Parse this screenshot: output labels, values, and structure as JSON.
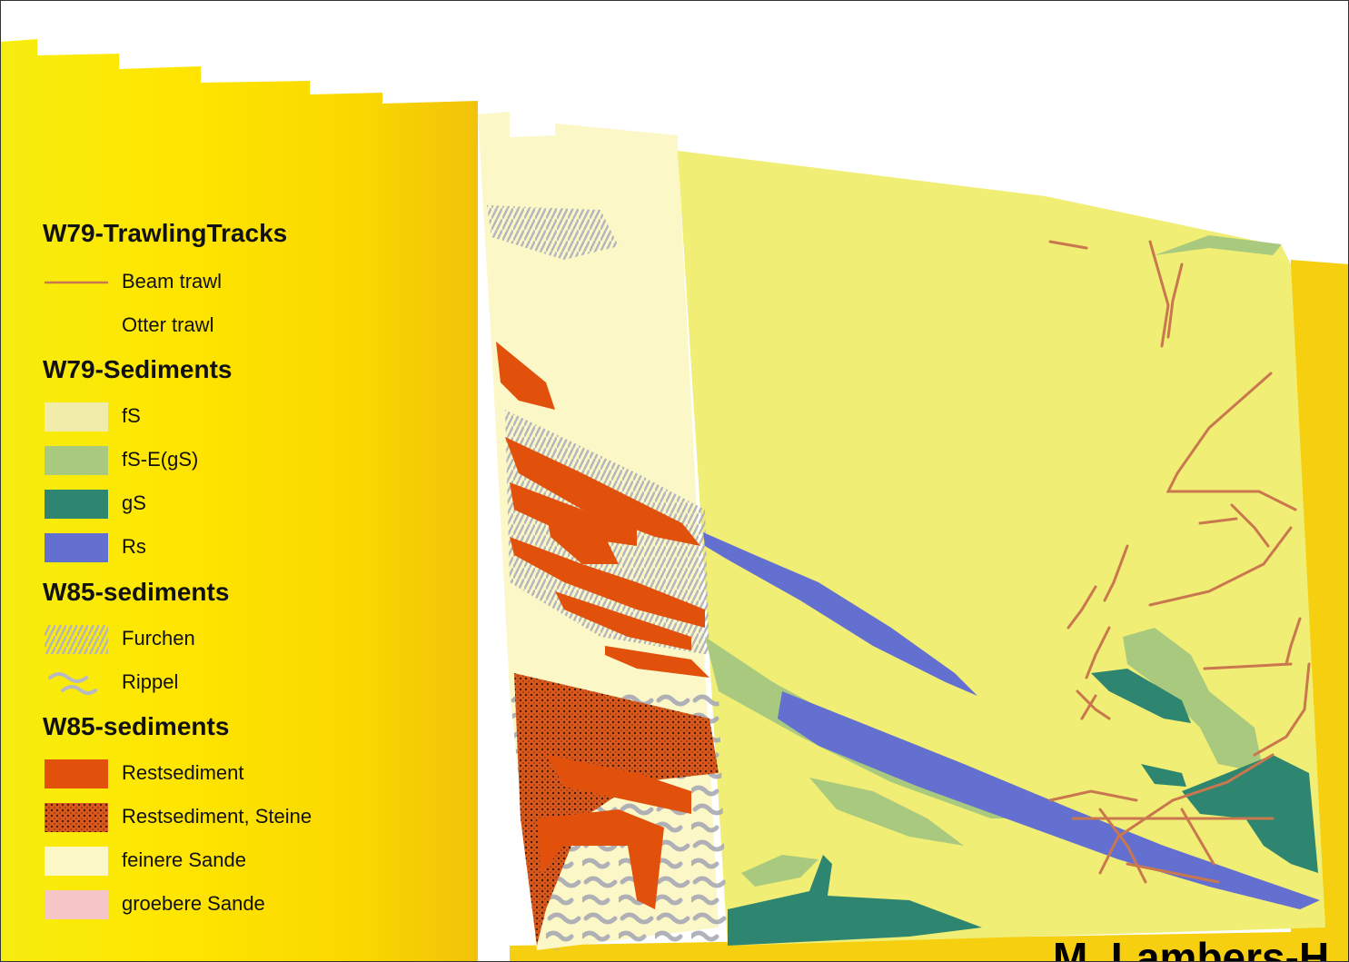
{
  "legend": {
    "groups": [
      {
        "title": "W79-TrawlingTracks",
        "items": [
          {
            "label": "Beam trawl",
            "symbol": "line",
            "color": "#c9774f"
          },
          {
            "label": "Otter trawl",
            "symbol": "none",
            "color": ""
          }
        ]
      },
      {
        "title": "W79-Sediments",
        "items": [
          {
            "label": "fS",
            "symbol": "fill",
            "color": "#f2ecaa"
          },
          {
            "label": "fS-E(gS)",
            "symbol": "fill",
            "color": "#a9c97e"
          },
          {
            "label": "gS",
            "symbol": "fill",
            "color": "#2f8670"
          },
          {
            "label": "Rs",
            "symbol": "fill",
            "color": "#6470d0"
          }
        ]
      },
      {
        "title": "W85-sediments",
        "items": [
          {
            "label": "Furchen",
            "symbol": "hatch",
            "color": "#b9b9c2"
          },
          {
            "label": "Rippel",
            "symbol": "ripple",
            "color": "#b9b9c2"
          }
        ]
      },
      {
        "title": "W85-sediments",
        "items": [
          {
            "label": "Restsediment",
            "symbol": "fill",
            "color": "#e2510c"
          },
          {
            "label": "Restsediment, Steine",
            "symbol": "dots",
            "color": "#c44a18"
          },
          {
            "label": "feinere Sande",
            "symbol": "fill",
            "color": "#fbf7c6"
          },
          {
            "label": "groebere Sande",
            "symbol": "fill",
            "color": "#f6c5c8"
          }
        ]
      }
    ]
  },
  "author_label": "M. Lambers-H",
  "colors": {
    "background_yellow": "#ffe600",
    "western_sheet": "#fbf7c6",
    "eastern_sheet": "#f0ee74",
    "restsediment": "#e2510c",
    "trawl_track": "#c9774f",
    "fS_E_gS": "#a9c97e",
    "gS": "#2f8670",
    "Rs": "#6470d0"
  }
}
